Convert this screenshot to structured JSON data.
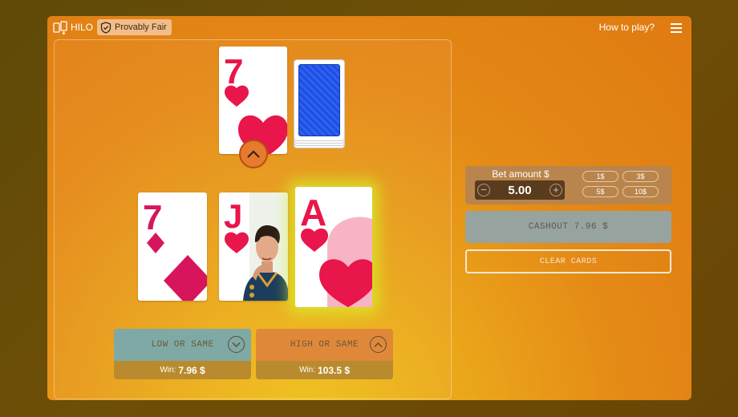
{
  "header": {
    "game_title": "HILO",
    "provably_fair": "Provably Fair",
    "how_to_play": "How to play?"
  },
  "current_card": {
    "rank": "7",
    "suit": "hearts",
    "color": "#e8164a"
  },
  "history_cards": [
    {
      "rank": "7",
      "suit": "diamonds",
      "color": "#d6155c"
    },
    {
      "rank": "J",
      "suit": "hearts",
      "color": "#e8164a"
    },
    {
      "rank": "A",
      "suit": "hearts",
      "color": "#e8164a"
    }
  ],
  "low_button": {
    "label": "LOW OR SAME",
    "win_label": "Win:",
    "win_value": "7.96 $"
  },
  "high_button": {
    "label": "HIGH OR SAME",
    "win_label": "Win:",
    "win_value": "103.5 $"
  },
  "bet": {
    "label": "Bet amount $",
    "value": "5.00",
    "minus": "−",
    "plus": "+",
    "chips": [
      "1$",
      "3$",
      "5$",
      "10$"
    ]
  },
  "cashout_label": "CASHOUT 7.96 $",
  "clear_label": "CLEAR CARDS",
  "colors": {
    "accent_orange": "#e48916",
    "low_button": "#7fa9a4",
    "high_button": "#e0883a",
    "win_bar": "#b98b2e"
  }
}
